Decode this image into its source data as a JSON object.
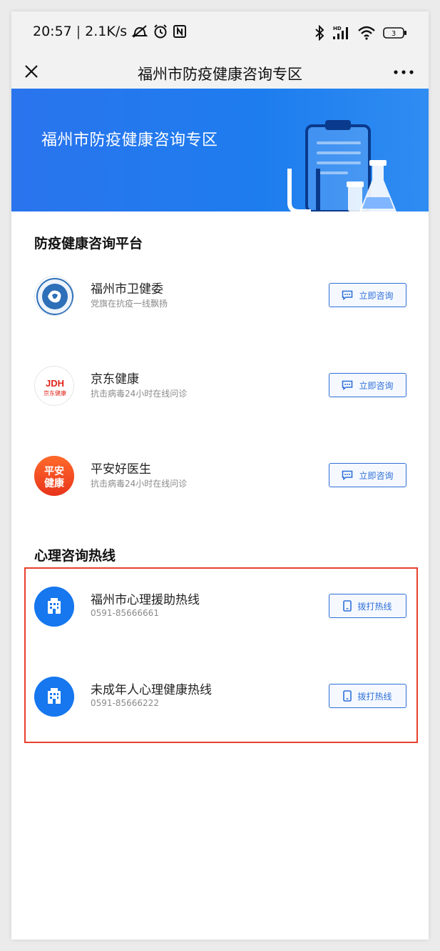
{
  "status_bar": {
    "time": "20:57",
    "speed": "2.1K/s",
    "battery": "3",
    "network": "HD"
  },
  "nav": {
    "title": "福州市防疫健康咨询专区"
  },
  "banner": {
    "title": "福州市防疫健康咨询专区"
  },
  "sections": [
    {
      "title": "防疫健康咨询平台",
      "items": [
        {
          "name": "福州市卫健委",
          "subtitle": "党旗在抗疫一线飘扬",
          "button": "立即咨询",
          "logo": "fuzhou-health-commission-logo"
        },
        {
          "name": "京东健康",
          "subtitle": "抗击病毒24小时在线问诊",
          "button": "立即咨询",
          "logo": "jd-health-logo",
          "logo_text_top": "JDH",
          "logo_text_bottom": "京东健康"
        },
        {
          "name": "平安好医生",
          "subtitle": "抗击病毒24小时在线问诊",
          "button": "立即咨询",
          "logo": "pingan-logo",
          "logo_text_top": "平安",
          "logo_text_bottom": "健康"
        }
      ]
    },
    {
      "title": "心理咨询热线",
      "items": [
        {
          "name": "福州市心理援助热线",
          "subtitle": "0591-85666661",
          "button": "拨打热线",
          "logo": "hospital-icon"
        },
        {
          "name": "未成年人心理健康热线",
          "subtitle": "0591-85666222",
          "button": "拨打热线",
          "logo": "hospital-icon"
        }
      ]
    }
  ],
  "colors": {
    "brand_blue": "#1e7dee",
    "button_blue": "#2f6fd8",
    "highlight_red": "#e8402c",
    "pingan_orange": "#f04e23",
    "jd_red": "#e1251b"
  }
}
